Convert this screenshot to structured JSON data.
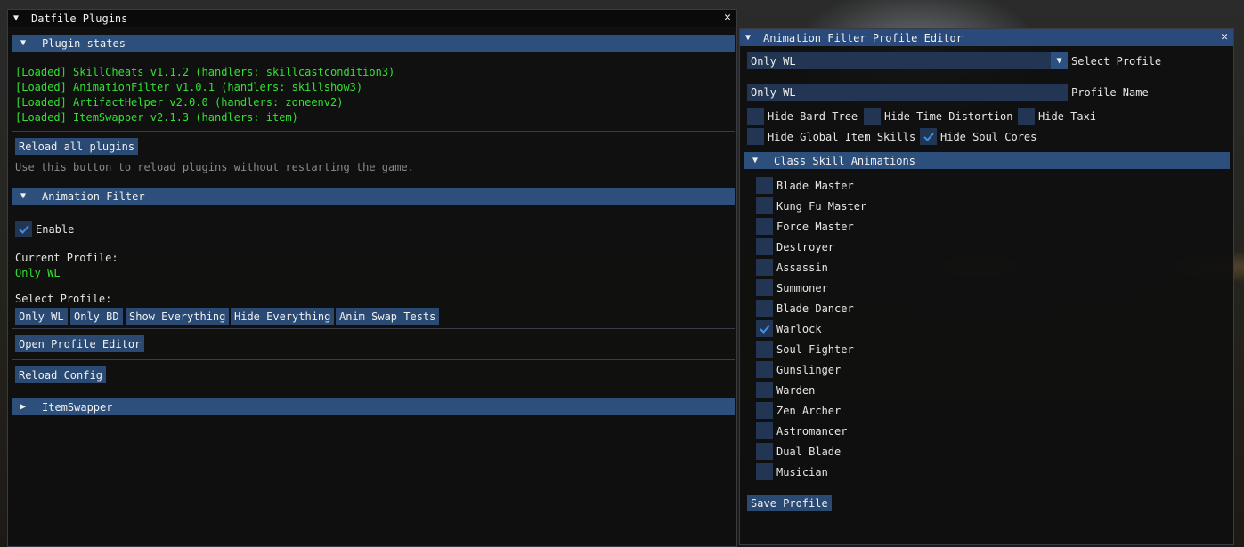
{
  "colors": {
    "accent": "#2c4f7c",
    "green_text": "#33e033",
    "check": "#3d8fe8"
  },
  "win1": {
    "title": "Datfile Plugins",
    "plugin_states": {
      "header": "Plugin states",
      "lines": [
        "[Loaded] SkillCheats v1.1.2 (handlers: skillcastcondition3)",
        "[Loaded] AnimationFilter v1.0.1 (handlers: skillshow3)",
        "[Loaded] ArtifactHelper v2.0.0 (handlers: zoneenv2)",
        "[Loaded] ItemSwapper v2.1.3 (handlers: item)"
      ],
      "reload_button": "Reload all plugins",
      "hint": "Use this button to reload plugins without restarting the game."
    },
    "animation_filter": {
      "header": "Animation Filter",
      "enable_label": "Enable",
      "current_profile_label": "Current Profile:",
      "current_profile_value": "Only WL",
      "select_profile_label": "Select Profile:",
      "profiles": [
        "Only WL",
        "Only BD",
        "Show Everything",
        "Hide Everything",
        "Anim Swap Tests"
      ],
      "open_editor_button": "Open Profile Editor",
      "reload_config_button": "Reload Config"
    },
    "item_swapper": {
      "header": "ItemSwapper"
    }
  },
  "win2": {
    "title": "Animation Filter Profile Editor",
    "select_profile": {
      "value": "Only WL",
      "label": "Select Profile"
    },
    "profile_name": {
      "value": "Only WL",
      "label": "Profile Name"
    },
    "options_row1": [
      "Hide Bard Tree",
      "Hide Time Distortion",
      "Hide Taxi"
    ],
    "options_row2": [
      "Hide Global Item Skills",
      "Hide Soul Cores"
    ],
    "class_section": {
      "header": "Class Skill Animations",
      "classes": [
        "Blade Master",
        "Kung Fu Master",
        "Force Master",
        "Destroyer",
        "Assassin",
        "Summoner",
        "Blade Dancer",
        "Warlock",
        "Soul Fighter",
        "Gunslinger",
        "Warden",
        "Zen Archer",
        "Astromancer",
        "Dual Blade",
        "Musician"
      ]
    },
    "save_button": "Save Profile"
  }
}
